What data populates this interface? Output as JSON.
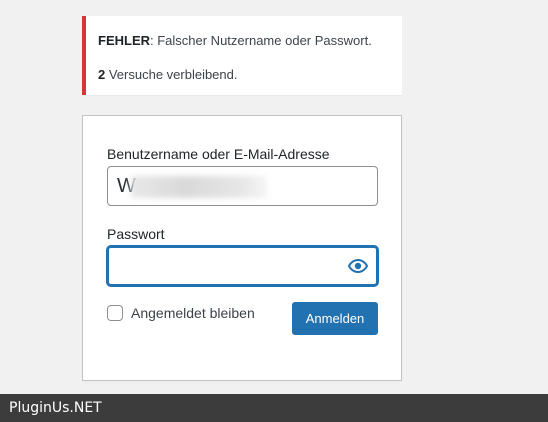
{
  "notice": {
    "error_label": "FEHLER",
    "error_message": ": Falscher Nutzername oder Passwort.",
    "attempts_count": "2",
    "attempts_text": " Versuche verbleibend."
  },
  "login_form": {
    "username_label": "Benutzername oder E-Mail-Adresse",
    "username_value_visible": "W",
    "password_label": "Passwort",
    "password_value": "",
    "show_password_icon": "eye-icon",
    "remember_label": "Angemeldet bleiben",
    "remember_checked": false,
    "submit_label": "Anmelden"
  },
  "watermark": {
    "text": "PluginUs.NET"
  },
  "colors": {
    "error": "#d63638",
    "accent": "#2271b1",
    "background": "#f1f1f1"
  }
}
